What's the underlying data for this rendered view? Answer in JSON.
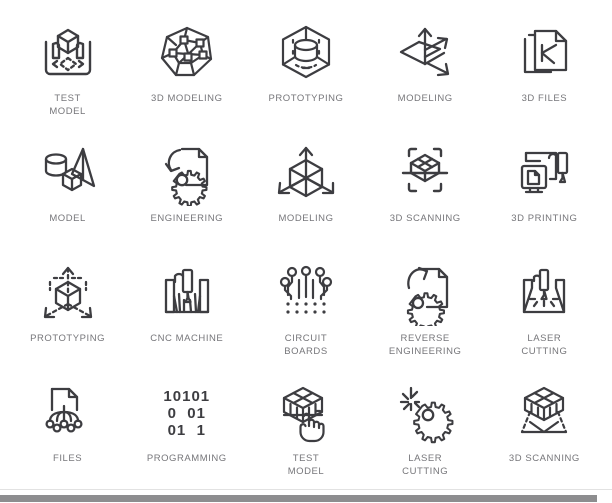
{
  "page": {
    "background_color": "#ffffff",
    "stroke_color": "#3d3d41",
    "label_color": "#76767a"
  },
  "icon_grid": {
    "columns": 5,
    "rows": 4,
    "items": [
      {
        "icon": "3d-printer-bed-cube-arrows-icon",
        "label": "TEST\nMODEL"
      },
      {
        "icon": "polygon-mesh-wireframe-icon",
        "label": "3D MODELING"
      },
      {
        "icon": "hexagon-cylinder-prototype-icon",
        "label": "PROTOTYPING"
      },
      {
        "icon": "axis-arrows-plane-icon",
        "label": "MODELING"
      },
      {
        "icon": "stacked-documents-3d-icon",
        "label": "3D FILES"
      },
      {
        "icon": "cylinder-cube-cone-shapes-icon",
        "label": "MODEL"
      },
      {
        "icon": "document-gear-refresh-icon",
        "label": "ENGINEERING"
      },
      {
        "icon": "cube-axis-arrows-icon",
        "label": "MODELING"
      },
      {
        "icon": "cube-scan-brackets-icon",
        "label": "3D SCANNING"
      },
      {
        "icon": "printer-monitor-document-icon",
        "label": "3D PRINTING"
      },
      {
        "icon": "cube-dashed-arrows-icon",
        "label": "PROTOTYPING"
      },
      {
        "icon": "cnc-milling-machine-icon",
        "label": "CNC MACHINE"
      },
      {
        "icon": "circuit-board-nodes-icon",
        "label": "CIRCUIT\nBOARDS"
      },
      {
        "icon": "document-gear-arrow-icon",
        "label": "REVERSE\nENGINEERING"
      },
      {
        "icon": "laser-cutter-beam-icon",
        "label": "LASER\nCUTTING"
      },
      {
        "icon": "document-circuit-tree-icon",
        "label": "FILES"
      },
      {
        "icon": "binary-code-icon",
        "label": "PROGRAMMING"
      },
      {
        "icon": "cube-grid-hand-touch-icon",
        "label": "TEST\nMODEL"
      },
      {
        "icon": "gear-laser-spark-icon",
        "label": "LASER\nCUTTING"
      },
      {
        "icon": "cube-scan-rays-icon",
        "label": "3D SCANNING"
      }
    ]
  },
  "binary_icon": {
    "line1": "10101",
    "line2": "0  01",
    "line3": "01  1"
  },
  "scrollbar": {
    "orientation": "horizontal",
    "thumb_color": "#8d8d8f"
  }
}
